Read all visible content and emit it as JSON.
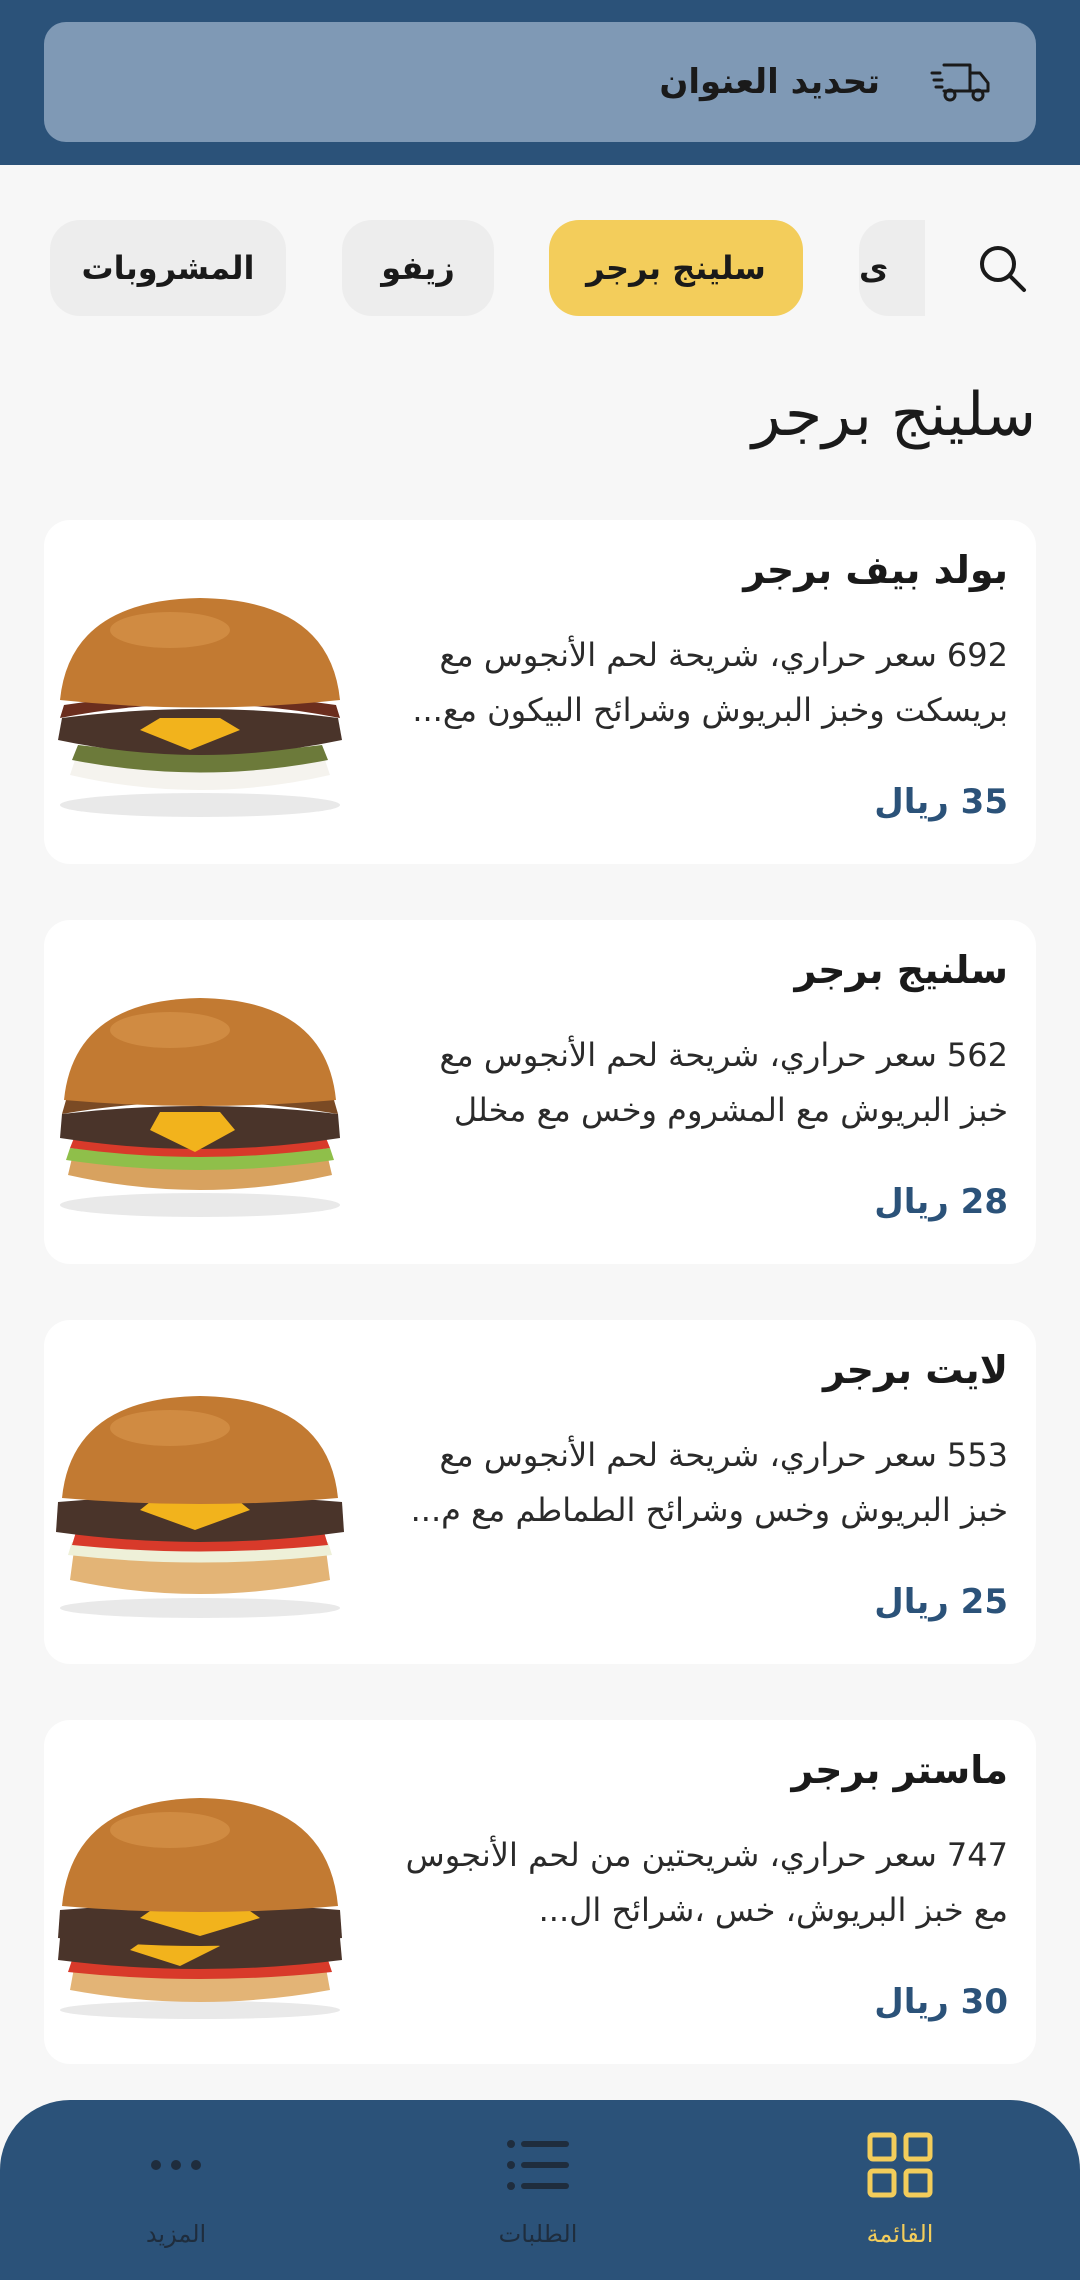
{
  "header": {
    "address_label": "تحديد العنوان",
    "icon": "delivery-truck-icon"
  },
  "categories": {
    "items": [
      {
        "label": "المشروبات",
        "active": false
      },
      {
        "label": "زيفو",
        "active": false
      },
      {
        "label": "سلينج برجر",
        "active": true
      },
      {
        "label": "ى",
        "active": false
      }
    ],
    "search_icon": "search-icon"
  },
  "section": {
    "title": "سلينج برجر"
  },
  "products": [
    {
      "name": "بولد بيف برجر",
      "description": "692 سعر حراري، شريحة لحم الأنجوس مع بريسكت وخبز البريوش وشرائح البيكون مع...",
      "price": "35 ريال"
    },
    {
      "name": "سلنيج برجر",
      "description": "562 سعر حراري، شريحة لحم الأنجوس مع خبز البريوش مع المشروم وخس مع مخلل ال..",
      "price": "28 ريال"
    },
    {
      "name": "لايت برجر",
      "description": "553 سعر حراري، شريحة لحم الأنجوس مع خبز البريوش وخس وشرائح الطماطم مع م...",
      "price": "25 ريال"
    },
    {
      "name": "ماستر برجر",
      "description": "747 سعر حراري، شريحتين من لحم الأنجوس مع خبز البريوش، خس ،شرائح ال...",
      "price": "30 ريال"
    }
  ],
  "bottom_nav": {
    "items": [
      {
        "label": "المزيد",
        "icon": "more-dots-icon",
        "active": false
      },
      {
        "label": "الطلبات",
        "icon": "list-icon",
        "active": false
      },
      {
        "label": "القائمة",
        "icon": "grid-menu-icon",
        "active": true
      }
    ]
  },
  "colors": {
    "primary": "#2b5279",
    "accent": "#f3cd5b",
    "address_bar": "#7f99b5",
    "chip_bg": "#ededed",
    "background": "#f7f7f7"
  }
}
